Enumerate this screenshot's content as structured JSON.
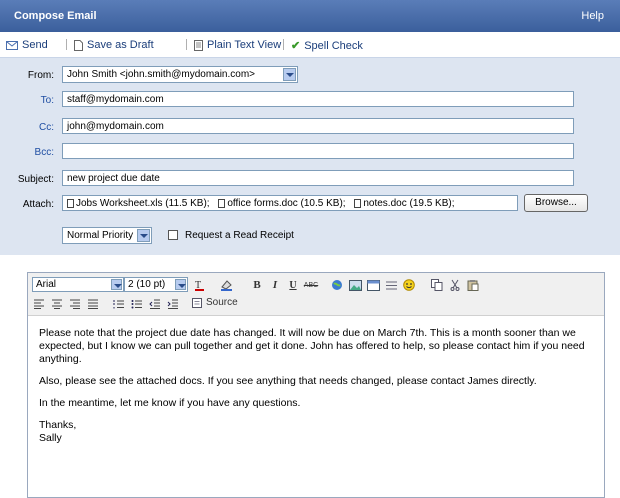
{
  "window": {
    "title": "Compose Email",
    "help": "Help"
  },
  "toolbar": {
    "send": "Send",
    "save_draft": "Save as Draft",
    "plain_text": "Plain Text View",
    "spell_check": "Spell Check"
  },
  "form": {
    "from_label": "From:",
    "from_value": "John Smith <john.smith@mydomain.com>",
    "to_label": "To:",
    "to_value": "staff@mydomain.com",
    "cc_label": "Cc:",
    "cc_value": "john@mydomain.com",
    "bcc_label": "Bcc:",
    "bcc_value": "",
    "subject_label": "Subject:",
    "subject_value": "new project due date",
    "attach_label": "Attach:",
    "attachments": [
      "Jobs Worksheet.xls (11.5 KB);",
      "office forms.doc (10.5 KB);",
      "notes.doc (19.5 KB);"
    ],
    "browse": "Browse...",
    "priority": "Normal Priority",
    "read_receipt": "Request a Read Receipt"
  },
  "editor": {
    "font": "Arial",
    "size": "2 (10 pt)",
    "source": "Source",
    "body": [
      "Please note that the project due date has changed. It will now be due on March 7th. This is a month sooner than we expected, but I know we can pull together and get it done. John has offered to help, so please contact him if you need anything.",
      "Also, please see the attached docs. If you see anything that needs changed, please contact James directly.",
      "In the meantime, let me know if you have any questions.",
      "Thanks,",
      "Sally"
    ]
  }
}
